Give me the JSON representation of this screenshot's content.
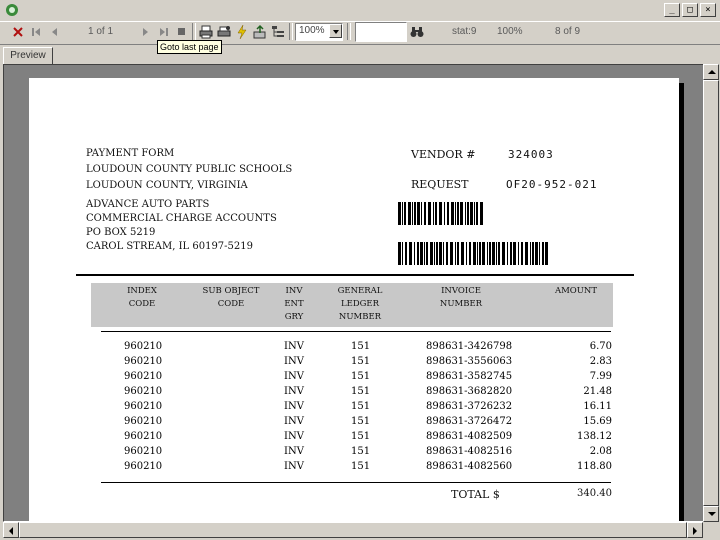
{
  "toolbar": {
    "page_indicator": "1 of 1",
    "zoom_value": "100%",
    "search_value": "",
    "status": "stat:9",
    "zoom_percent": "100%",
    "page_count": "8 of 9"
  },
  "tooltip": "Goto last page",
  "tabs": [
    {
      "label": "Preview"
    }
  ],
  "document": {
    "title_lines": [
      "PAYMENT FORM",
      "LOUDOUN COUNTY PUBLIC SCHOOLS",
      "LOUDOUN COUNTY, VIRGINIA"
    ],
    "vendor_label": "VENDOR #",
    "vendor_value": "324003",
    "request_label": "REQUEST",
    "request_value": "OF20-952-021",
    "address_lines": [
      "ADVANCE AUTO PARTS",
      "COMMERCIAL CHARGE ACCOUNTS",
      "PO BOX 5219",
      "CAROL STREAM, IL 60197-5219"
    ],
    "headers": {
      "index": "INDEX\nCODE",
      "sub_object": "SUB OBJECT\nCODE",
      "inv_ent_gry": "INV\nENT\nGRY",
      "general_ledger": "GENERAL\nLEDGER\nNUMBER",
      "invoice": "INVOICE\nNUMBER",
      "amount": "AMOUNT"
    },
    "rows": [
      {
        "index": "960210",
        "inv": "INV",
        "ledger": "151",
        "invoice": "898631-3426798",
        "amount": "6.70"
      },
      {
        "index": "960210",
        "inv": "INV",
        "ledger": "151",
        "invoice": "898631-3556063",
        "amount": "2.83"
      },
      {
        "index": "960210",
        "inv": "INV",
        "ledger": "151",
        "invoice": "898631-3582745",
        "amount": "7.99"
      },
      {
        "index": "960210",
        "inv": "INV",
        "ledger": "151",
        "invoice": "898631-3682820",
        "amount": "21.48"
      },
      {
        "index": "960210",
        "inv": "INV",
        "ledger": "151",
        "invoice": "898631-3726232",
        "amount": "16.11"
      },
      {
        "index": "960210",
        "inv": "INV",
        "ledger": "151",
        "invoice": "898631-3726472",
        "amount": "15.69"
      },
      {
        "index": "960210",
        "inv": "INV",
        "ledger": "151",
        "invoice": "898631-4082509",
        "amount": "138.12"
      },
      {
        "index": "960210",
        "inv": "INV",
        "ledger": "151",
        "invoice": "898631-4082516",
        "amount": "2.08"
      },
      {
        "index": "960210",
        "inv": "INV",
        "ledger": "151",
        "invoice": "898631-4082560",
        "amount": "118.80"
      }
    ],
    "total_label": "TOTAL $",
    "total_value": "340.40"
  },
  "colors": {
    "window_bg": "#d4d0c8",
    "viewer_bg": "#808080",
    "header_band": "#c8c8c8",
    "tooltip_bg": "#ffffe1"
  }
}
